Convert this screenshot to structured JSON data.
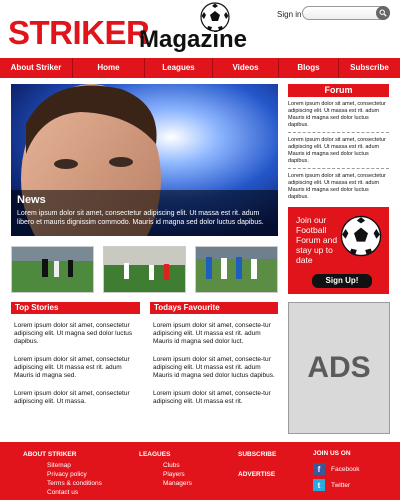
{
  "header": {
    "logo_word1": "STRIKER",
    "logo_word2": "Magazine",
    "signin_label": "Sign in",
    "signin_placeholder": ""
  },
  "nav": [
    "About Striker",
    "Home",
    "Leagues",
    "Videos",
    "Blogs",
    "Subscribe"
  ],
  "hero": {
    "title": "News",
    "text": "Lorem ipsum dolor sit amet, consectetur adipiscing elit. Ut massa est rit. adum libero et mauris dignissim commodo. Mauris id magna sed dolor luctus dapibus."
  },
  "forum": {
    "title": "Forum",
    "items": [
      "Lorem ipsum dolor sit amet, consectetur adipiscing elit. Ut massa est rit. adum Mauris id magna sed dolor luctus dapibus.",
      "Lorem ipsum dolor sit amet, consectetur adipiscing elit. Ut massa est rit. adum Mauris id magna sed dolor luctus dapibus.",
      "Lorem ipsum dolor sit amet, consectetur adipiscing elit. Ut massa est rit. adum Mauris id magna sed dolor luctus dapibus."
    ]
  },
  "join": {
    "text": "Join our Football Forum and stay up to date",
    "button": "Sign Up!"
  },
  "top_stories": {
    "title": "Top Stories",
    "paras": [
      "Lorem ipsum dolor sit amet, consectetur adipiscing elit. Ut magna sed dolor luctus dapibus.",
      "Lorem ipsum dolor sit amet, consectetur adipiscing elit. Ut massa est rit. adum Mauris id magna sed.",
      "Lorem ipsum dolor sit amet, consectetur adipiscing elit. Ut massa."
    ]
  },
  "favourite": {
    "title": "Todays Favourite",
    "paras": [
      "Lorem ipsum dolor sit amet, consecte-tur adipiscing elit. Ut massa est rit. adum Mauris id magna sed dolor luct.",
      "Lorem ipsum dolor sit amet, consecte-tur adipiscing elit. Ut massa est rit. adum Mauris id magna sed dolor luctus dapibus.",
      "Lorem ipsum dolor sit amet, consecte-tur adipiscing elit. Ut massa est rit."
    ]
  },
  "ads": "ADS",
  "footer": {
    "about": {
      "title": "ABOUT STRIKER",
      "links": [
        "Sitemap",
        "Privacy policy",
        "Terms & conditions",
        "Contact us"
      ]
    },
    "leagues": {
      "title": "LEAGUES",
      "links": [
        "Clubs",
        "Players",
        "Managers"
      ]
    },
    "subscribe": "SUBSCRIBE",
    "advertise": "ADVERTISE",
    "join": {
      "title": "JOIN US ON",
      "facebook": "Facebook",
      "twitter": "Twitter"
    }
  },
  "colors": {
    "accent": "#e1141b",
    "dark": "#111111"
  }
}
